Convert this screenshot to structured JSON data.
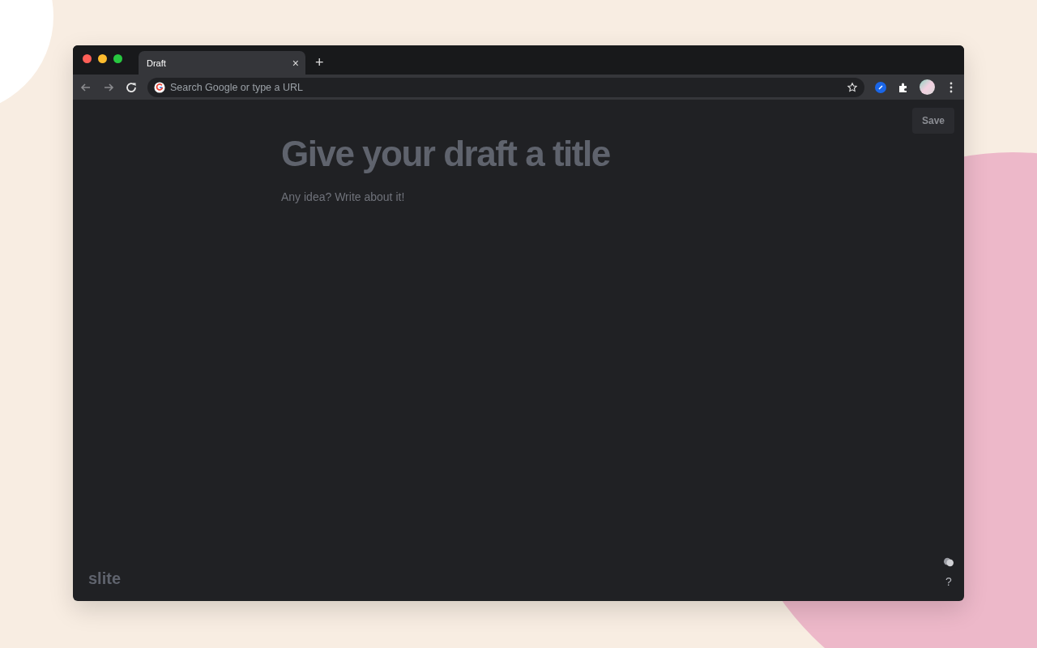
{
  "browser": {
    "tabs": [
      {
        "label": "Draft",
        "selected": true
      }
    ],
    "new_tab": "+",
    "close_tab": "×",
    "address_bar": {
      "placeholder": "Search Google or type a URL"
    }
  },
  "editor": {
    "save_button": "Save",
    "title": {
      "placeholder": "Give your draft a title"
    },
    "body": {
      "placeholder": "Any idea? Write about it!"
    }
  },
  "footer": {
    "logo": "slite",
    "help": "?"
  }
}
